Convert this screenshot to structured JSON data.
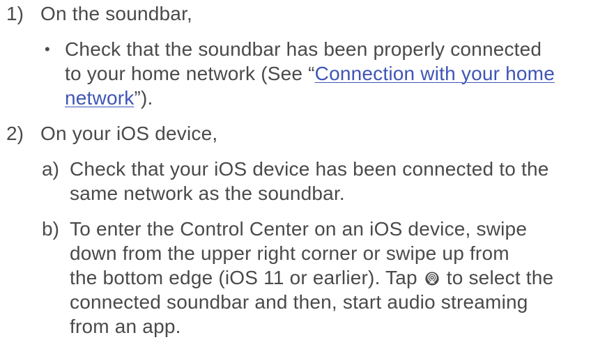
{
  "step1": {
    "number": "1)",
    "heading": "On the soundbar,",
    "bullet_symbol": "•",
    "bullet_line1": "Check that the soundbar has been properly connected",
    "bullet_line2_prefix": "to your home network (See “",
    "link_part1": "Connection with your home",
    "link_part2": "network",
    "bullet_line3_suffix": "”)."
  },
  "step2": {
    "number": "2)",
    "heading": "On your iOS device,",
    "a_marker": "a)",
    "a_line1": "Check that your iOS device has been connected to the",
    "a_line2": "same network as the soundbar.",
    "b_marker": "b)",
    "b_line1": "To enter the Control Center on an iOS device, swipe",
    "b_line2": "down from the upper right corner or swipe up from",
    "b_line3_prefix": "the bottom edge (iOS 11 or earlier). Tap",
    "b_line3_suffix": "to select the",
    "b_line4": "connected soundbar and then, start audio streaming",
    "b_line5": "from an app.",
    "icon": "airplay-icon"
  },
  "colors": {
    "text": "#4a4a4a",
    "link": "#3f55b5"
  }
}
